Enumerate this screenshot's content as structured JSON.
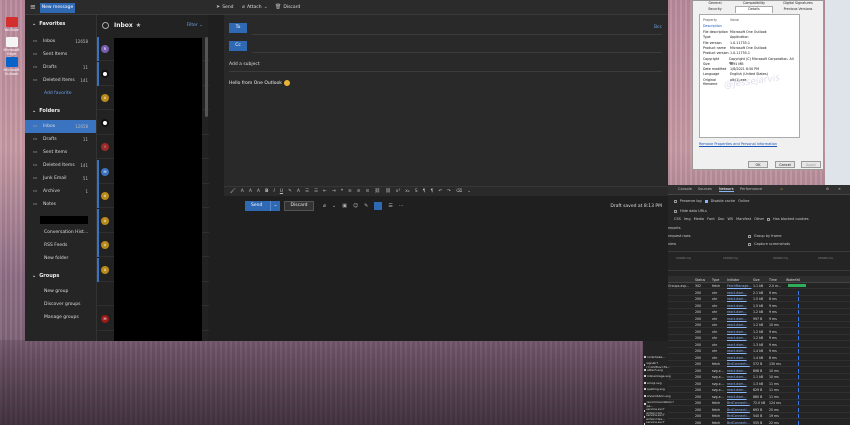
{
  "desktop": {
    "icons": [
      {
        "label": "YouTube",
        "color": "#d32f2f"
      },
      {
        "label": "Microsoft Edge (Dev)",
        "color": "#f4f4f4"
      },
      {
        "label": "Microsoft Outlook",
        "color": "#0a64c8"
      }
    ]
  },
  "outlook": {
    "toolbar": {
      "new_message": "New message",
      "send": "Send",
      "attach": "Attach",
      "discard": "Discard"
    },
    "favorites": {
      "title": "Favorites",
      "items": [
        {
          "label": "Inbox",
          "count": "12658",
          "icon": "inbox-icon"
        },
        {
          "label": "Sent Items",
          "count": "",
          "icon": "send-icon"
        },
        {
          "label": "Drafts",
          "count": "11",
          "icon": "drafts-icon"
        },
        {
          "label": "Deleted Items",
          "count": "141",
          "icon": "trash-icon"
        }
      ],
      "add": "Add favorite"
    },
    "folders": {
      "title": "Folders",
      "items": [
        {
          "label": "Inbox",
          "count": "12658",
          "icon": "inbox-icon"
        },
        {
          "label": "Drafts",
          "count": "11",
          "icon": "drafts-icon"
        },
        {
          "label": "Sent Items",
          "count": "",
          "icon": "send-icon"
        },
        {
          "label": "Deleted Items",
          "count": "141",
          "icon": "trash-icon"
        },
        {
          "label": "Junk Email",
          "count": "51",
          "icon": "junk-icon"
        },
        {
          "label": "Archive",
          "count": "1",
          "icon": "archive-icon"
        },
        {
          "label": "Notes",
          "count": "",
          "icon": "notes-icon"
        }
      ],
      "links": [
        "Conversation Hist…",
        "RSS Feeds",
        "New folder"
      ]
    },
    "groups": {
      "title": "Groups",
      "links": [
        "New group",
        "Discover groups",
        "Manage groups"
      ]
    },
    "list": {
      "title": "Inbox",
      "filter": "Filter",
      "avatars": [
        {
          "letter": "R",
          "color": "#7a5fb0"
        },
        {
          "letter": "",
          "color": "#ffffff"
        },
        {
          "letter": "A",
          "color": "#b88a1a"
        },
        {
          "letter": "",
          "color": "#ffffff"
        },
        {
          "letter": "I",
          "color": "#9a2a2a"
        },
        {
          "letter": "M",
          "color": "#3a73c0"
        },
        {
          "letter": "A",
          "color": "#b88a1a"
        },
        {
          "letter": "A",
          "color": "#b88a1a"
        },
        {
          "letter": "A",
          "color": "#b88a1a"
        },
        {
          "letter": "A",
          "color": "#b88a1a"
        },
        {
          "letter": "",
          "color": "#222222"
        },
        {
          "letter": "M",
          "color": "#9a1a1a"
        }
      ]
    },
    "compose": {
      "to": "To",
      "cc": "Cc",
      "bcc": "Bcc",
      "subject_placeholder": "Add a subject",
      "body": "Hello from One Outlook",
      "send": "Send",
      "discard": "Discard",
      "draft_status": "Draft saved at 8:13 PM"
    }
  },
  "properties": {
    "tabs": [
      "General",
      "Compatibility",
      "Digital Signatures",
      "Security",
      "Details",
      "Previous Versions"
    ],
    "header": {
      "property": "Property",
      "value": "Value"
    },
    "section": "Description",
    "rows": [
      {
        "k": "File description",
        "v": "Microsoft One Outlook"
      },
      {
        "k": "Type",
        "v": "Application"
      },
      {
        "k": "File version",
        "v": "1.0.11755.1"
      },
      {
        "k": "Product name",
        "v": "Microsoft One Outlook"
      },
      {
        "k": "Product version",
        "v": "1.0.11755.1"
      },
      {
        "k": "Copyright",
        "v": "Copyright (C) Microsoft Corporation. All rig..."
      },
      {
        "k": "Size",
        "v": "6.51 MB"
      },
      {
        "k": "Date modified",
        "v": "1/8/2021 8:50 PM"
      },
      {
        "k": "Language",
        "v": "English (United States)"
      },
      {
        "k": "Original filename",
        "v": "olk(1).exe"
      }
    ],
    "watermark": "@jessejarvis",
    "link": "Remove Properties and Personal Information",
    "buttons": [
      "OK",
      "Cancel",
      "Apply"
    ]
  },
  "devtools": {
    "tabs": [
      "Console",
      "Sources",
      "Network",
      "Performance"
    ],
    "options": {
      "preserve_log": "Preserve log",
      "disable_cache": "Disable cache",
      "online": "Online",
      "hide_data": "Hide data URLs",
      "has_blocked": "Has blocked cookies",
      "blocked_requests": "Blocked Requests",
      "group_by_frame": "Group by frame",
      "capture_screenshots": "Capture screenshots",
      "reports_label": "reports",
      "request_rows": "request rows",
      "overview": "view"
    },
    "filters": [
      "CSS",
      "Img",
      "Media",
      "Font",
      "Doc",
      "WS",
      "Manifest",
      "Other"
    ],
    "timeline": [
      "10000 ms",
      "15000 ms",
      "20000 ms",
      "25000 ms"
    ],
    "columns": [
      "Status",
      "Type",
      "Initiator",
      "Size",
      "Time",
      "Waterfall"
    ],
    "rows": [
      {
        "name": "Groups.asp…",
        "status": "302",
        "type": "fetch",
        "init": "FetchManage…",
        "size": "1.1 kB",
        "time": "2.0 m…"
      },
      {
        "name": "",
        "status": "200",
        "type": "xhr",
        "init": "react-dom…",
        "size": "2.1 kB",
        "time": "9 ms"
      },
      {
        "name": "",
        "status": "200",
        "type": "xhr",
        "init": "react-dom…",
        "size": "1.5 kB",
        "time": "8 ms"
      },
      {
        "name": "",
        "status": "200",
        "type": "xhr",
        "init": "react-dom…",
        "size": "1.5 kB",
        "time": "9 ms"
      },
      {
        "name": "",
        "status": "200",
        "type": "xhr",
        "init": "react-dom…",
        "size": "1.2 kB",
        "time": "9 ms"
      },
      {
        "name": "",
        "status": "200",
        "type": "xhr",
        "init": "react-dom…",
        "size": "997 B",
        "time": "9 ms"
      },
      {
        "name": "",
        "status": "200",
        "type": "xhr",
        "init": "react-dom…",
        "size": "1.2 kB",
        "time": "10 ms"
      },
      {
        "name": "",
        "status": "200",
        "type": "xhr",
        "init": "react-dom…",
        "size": "1.2 kB",
        "time": "9 ms"
      },
      {
        "name": "",
        "status": "200",
        "type": "xhr",
        "init": "react-dom…",
        "size": "1.2 kB",
        "time": "9 ms"
      },
      {
        "name": "",
        "status": "200",
        "type": "xhr",
        "init": "react-dom…",
        "size": "1.3 kB",
        "time": "9 ms"
      },
      {
        "name": "",
        "status": "200",
        "type": "xhr",
        "init": "react-dom…",
        "size": "1.4 kB",
        "time": "9 ms"
      },
      {
        "name": "node?ieke…",
        "status": "200",
        "type": "xhr",
        "init": "react-dom…",
        "size": "1.4 kB",
        "time": "8 ms"
      },
      {
        "name": "signalr?r=1228uv=Fe…",
        "status": "200",
        "type": "fetch",
        "init": "BrdConnecti…",
        "size": "572 B",
        "time": "130 ms"
      },
      {
        "name": "attach.svg",
        "status": "200",
        "type": "svg-x…",
        "init": "react-dom…",
        "size": "898 B",
        "time": "10 ms"
      },
      {
        "name": "inlineimage.svg",
        "status": "200",
        "type": "svg-x…",
        "init": "react-dom…",
        "size": "1.1 kB",
        "time": "10 ms"
      },
      {
        "name": "emoji.svg",
        "status": "200",
        "type": "svg-x…",
        "init": "react-dom…",
        "size": "1.3 kB",
        "time": "11 ms"
      },
      {
        "name": "spelling.svg",
        "status": "200",
        "type": "svg-x…",
        "init": "react-dom…",
        "size": "829 B",
        "time": "11 ms"
      },
      {
        "name": "showribbon.svg",
        "status": "200",
        "type": "svg-x…",
        "init": "react-dom…",
        "size": "880 B",
        "time": "11 ms"
      },
      {
        "name": "recommendation?pa…",
        "status": "200",
        "type": "fetch",
        "init": "BrdConnecti…",
        "size": "72.0 kB",
        "time": "124 ms"
      },
      {
        "name": "service.svc?action=Ad…",
        "status": "200",
        "type": "fetch",
        "init": "BrdConnecti…",
        "size": "693 B",
        "time": "25 ms"
      },
      {
        "name": "service.svc?action=Ge…",
        "status": "200",
        "type": "fetch",
        "init": "BrdConnecti…",
        "size": "540 B",
        "time": "19 ms"
      },
      {
        "name": "service.svc?action=Ge…",
        "status": "200",
        "type": "fetch",
        "init": "BrdConnecti…",
        "size": "555 B",
        "time": "22 ms"
      }
    ]
  }
}
